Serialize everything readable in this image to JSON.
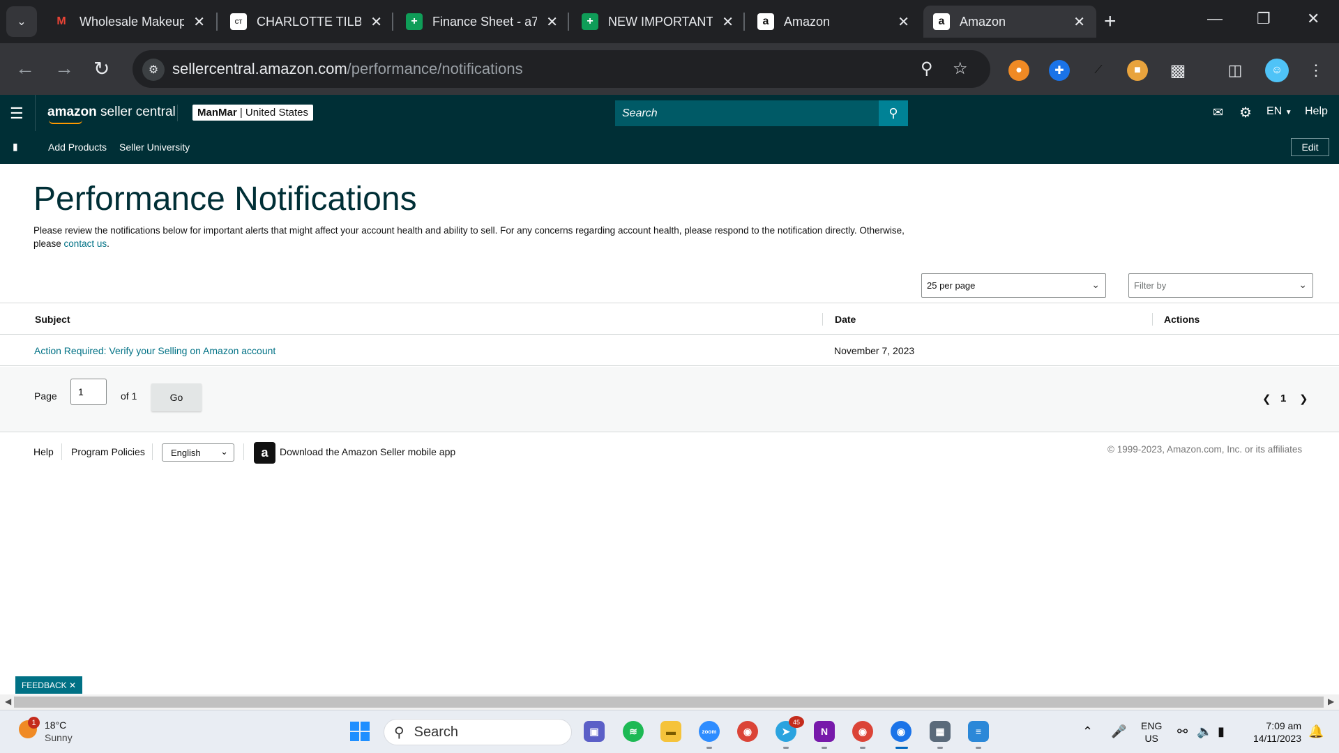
{
  "browser": {
    "tabs": [
      {
        "title": "Wholesale Makeup",
        "favicon": "gmail-icon",
        "color": "#ea4335",
        "glyph": "M"
      },
      {
        "title": "CHARLOTTE TILBURY",
        "favicon": "charlotte-tilbury-icon",
        "color": "#ffffff",
        "glyph": "CT"
      },
      {
        "title": "Finance Sheet - a7",
        "favicon": "sheets-icon",
        "color": "#0f9d58",
        "glyph": "+"
      },
      {
        "title": "NEW IMPORTANT",
        "favicon": "sheets-icon",
        "color": "#0f9d58",
        "glyph": "+"
      },
      {
        "title": "Amazon",
        "favicon": "amazon-icon",
        "color": "#ffffff",
        "glyph": "a"
      },
      {
        "title": "Amazon",
        "favicon": "amazon-icon",
        "color": "#ffffff",
        "glyph": "a"
      }
    ],
    "url_domain": "sellercentral.amazon.com",
    "url_path": "/performance/notifications"
  },
  "header": {
    "logo_bold": "amazon",
    "logo_rest": " seller central",
    "store_name": "ManMar",
    "store_region": " | United States",
    "search_placeholder": "Search",
    "language": "EN",
    "help": "Help"
  },
  "subnav": {
    "links": [
      "Add Products",
      "Seller University"
    ],
    "edit": "Edit"
  },
  "main": {
    "title": "Performance Notifications",
    "description": "Please review the notifications below for important alerts that might affect your account health and ability to sell. For any concerns regarding account health, please respond to the notification directly. Otherwise, please ",
    "contact_link": "contact us",
    "description_end": ".",
    "per_page": "25 per page",
    "filter_placeholder": "Filter by",
    "columns": [
      "Subject",
      "Date",
      "Actions"
    ],
    "rows": [
      {
        "subject": "Action Required: Verify your Selling on Amazon account",
        "date": "November 7, 2023",
        "actions": ""
      }
    ],
    "pager": {
      "page_label": "Page",
      "page_value": "1",
      "of_label": "of 1",
      "go": "Go",
      "current": "1"
    }
  },
  "footer": {
    "help": "Help",
    "policies": "Program Policies",
    "language": "English",
    "app_text": "Download the Amazon Seller mobile app",
    "copyright": "© 1999-2023, Amazon.com, Inc. or its affiliates",
    "feedback": "FEEDBACK"
  },
  "taskbar": {
    "weather_temp": "18°C",
    "weather_desc": "Sunny",
    "weather_badge": "1",
    "search_placeholder": "Search",
    "telegram_badge": "45",
    "lang_top": "ENG",
    "lang_bottom": "US",
    "time": "7:09 am",
    "date": "14/11/2023"
  },
  "colors": {
    "header_bg": "#002f36",
    "link": "#007185",
    "search_btn": "#008296"
  }
}
